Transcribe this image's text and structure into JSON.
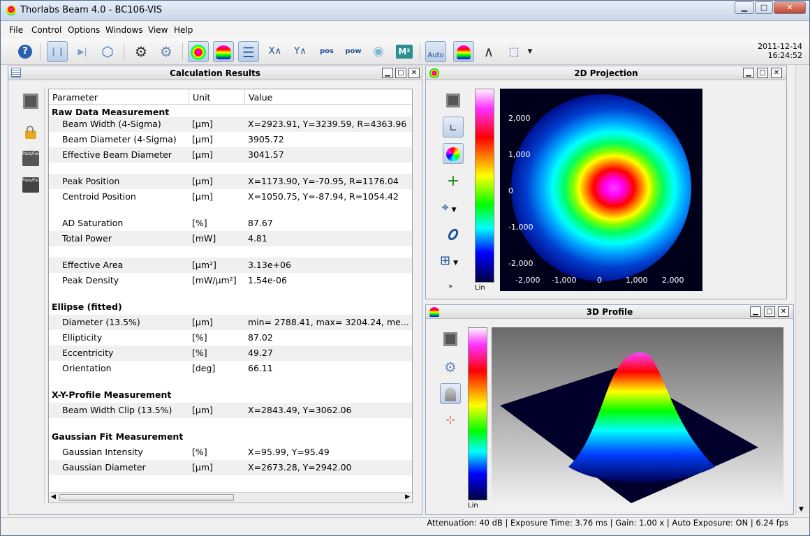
{
  "window": {
    "title": "Thorlabs Beam 4.0 - BC106-VIS",
    "minimize": "▁",
    "maximize": "□",
    "close": "✕"
  },
  "menu": [
    "File",
    "Control",
    "Options",
    "Windows",
    "View",
    "Help"
  ],
  "toolbar": {
    "datetime_date": "2011-12-14",
    "datetime_time": "16:24:52",
    "buttons": [
      {
        "name": "help-icon",
        "glyph": "?"
      },
      {
        "name": "pause-icon",
        "glyph": "❙❙"
      },
      {
        "name": "step-icon",
        "glyph": "▶|"
      },
      {
        "name": "camera-settings-icon",
        "glyph": "⬡"
      },
      {
        "name": "settings-icon",
        "glyph": "⚙"
      },
      {
        "name": "calc-settings-icon",
        "glyph": "⚙"
      },
      {
        "name": "2d-projection-icon",
        "glyph": "◎"
      },
      {
        "name": "3d-profile-icon",
        "glyph": "▲"
      },
      {
        "name": "calc-results-icon",
        "glyph": "☰"
      },
      {
        "name": "x-profile-icon",
        "glyph": "X∧"
      },
      {
        "name": "y-profile-icon",
        "glyph": "Y∧"
      },
      {
        "name": "position-icon",
        "glyph": "pos"
      },
      {
        "name": "power-icon",
        "glyph": "pow"
      },
      {
        "name": "camera-icon",
        "glyph": "◉"
      },
      {
        "name": "m2-icon",
        "glyph": "M²"
      },
      {
        "name": "auto-icon",
        "glyph": "Auto"
      },
      {
        "name": "color-map-icon",
        "glyph": "▲"
      },
      {
        "name": "gauss-icon",
        "glyph": "∧"
      },
      {
        "name": "zoom-box-icon",
        "glyph": "⬚"
      },
      {
        "name": "dropdown-icon",
        "glyph": "▼"
      }
    ]
  },
  "calc_panel": {
    "title": "Calculation Results",
    "columns": [
      "Parameter",
      "Unit",
      "Value"
    ],
    "rows": [
      {
        "type": "section",
        "param": "Raw Data Measurement",
        "unit": "",
        "value": ""
      },
      {
        "type": "item",
        "param": "Beam Width (4-Sigma)",
        "unit": "[µm]",
        "value": "X=2923.91, Y=3239.59, R=4363.96"
      },
      {
        "type": "item",
        "param": "Beam Diameter (4-Sigma)",
        "unit": "[µm]",
        "value": "3905.72"
      },
      {
        "type": "item",
        "param": "Effective Beam Diameter",
        "unit": "[µm]",
        "value": "3041.57"
      },
      {
        "type": "blank",
        "param": "",
        "unit": "",
        "value": ""
      },
      {
        "type": "item",
        "param": "Peak Position",
        "unit": "[µm]",
        "value": "X=1173.90, Y=-70.95, R=1176.04"
      },
      {
        "type": "item",
        "param": "Centroid Position",
        "unit": "[µm]",
        "value": "X=1050.75, Y=-87.94, R=1054.42"
      },
      {
        "type": "blank",
        "param": "",
        "unit": "",
        "value": ""
      },
      {
        "type": "item",
        "param": "AD Saturation",
        "unit": "[%]",
        "value": "87.67"
      },
      {
        "type": "item",
        "param": "Total Power",
        "unit": "[mW]",
        "value": "4.81"
      },
      {
        "type": "blank",
        "param": "",
        "unit": "",
        "value": ""
      },
      {
        "type": "item",
        "param": "Effective Area",
        "unit": "[µm²]",
        "value": "3.13e+06"
      },
      {
        "type": "item",
        "param": "Peak Density",
        "unit": "[mW/µm²]",
        "value": "1.54e-06"
      },
      {
        "type": "blank",
        "param": "",
        "unit": "",
        "value": ""
      },
      {
        "type": "section",
        "param": "Ellipse (fitted)",
        "unit": "",
        "value": ""
      },
      {
        "type": "item",
        "param": "Diameter (13.5%)",
        "unit": "[µm]",
        "value": "min= 2788.41, max= 3204.24, me..."
      },
      {
        "type": "item",
        "param": "Ellipticity",
        "unit": "[%]",
        "value": "87.02"
      },
      {
        "type": "item",
        "param": "Eccentricity",
        "unit": "[%]",
        "value": "49.27"
      },
      {
        "type": "item",
        "param": "Orientation",
        "unit": "[deg]",
        "value": "66.11"
      },
      {
        "type": "blank",
        "param": "",
        "unit": "",
        "value": ""
      },
      {
        "type": "section",
        "param": "X-Y-Profile Measurement",
        "unit": "",
        "value": ""
      },
      {
        "type": "item",
        "param": "Beam Width Clip (13.5%)",
        "unit": "[µm]",
        "value": "X=2843.49, Y=3062.06"
      },
      {
        "type": "blank",
        "param": "",
        "unit": "",
        "value": ""
      },
      {
        "type": "section",
        "param": "Gaussian Fit Measurement",
        "unit": "",
        "value": ""
      },
      {
        "type": "item",
        "param": "Gaussian Intensity",
        "unit": "[%]",
        "value": "X=95.99, Y=95.49"
      },
      {
        "type": "item",
        "param": "Gaussian Diameter",
        "unit": "[µm]",
        "value": "X=2673.28, Y=2942.00"
      }
    ],
    "side_icons": [
      "save-icon",
      "unlock-icon",
      "pass-fail-icon",
      "pass-fail-settings-icon"
    ],
    "pass_label": "Pass/Fail"
  },
  "projection_panel": {
    "title": "2D Projection",
    "scale_label": "Lin",
    "x_ticks": [
      "-2,000",
      "-1,000",
      "0",
      "1,000",
      "2,000"
    ],
    "y_ticks": [
      "2,000",
      "1,000",
      "0",
      "-1,000",
      "-2,000"
    ]
  },
  "profile_panel": {
    "title": "3D Profile",
    "scale_label": "Lin"
  },
  "status": {
    "text": "Attenuation: 40 dB |  Exposure Time: 3.76 ms |  Gain: 1.00 x |  Auto Exposure: ON |      6.24 fps"
  }
}
